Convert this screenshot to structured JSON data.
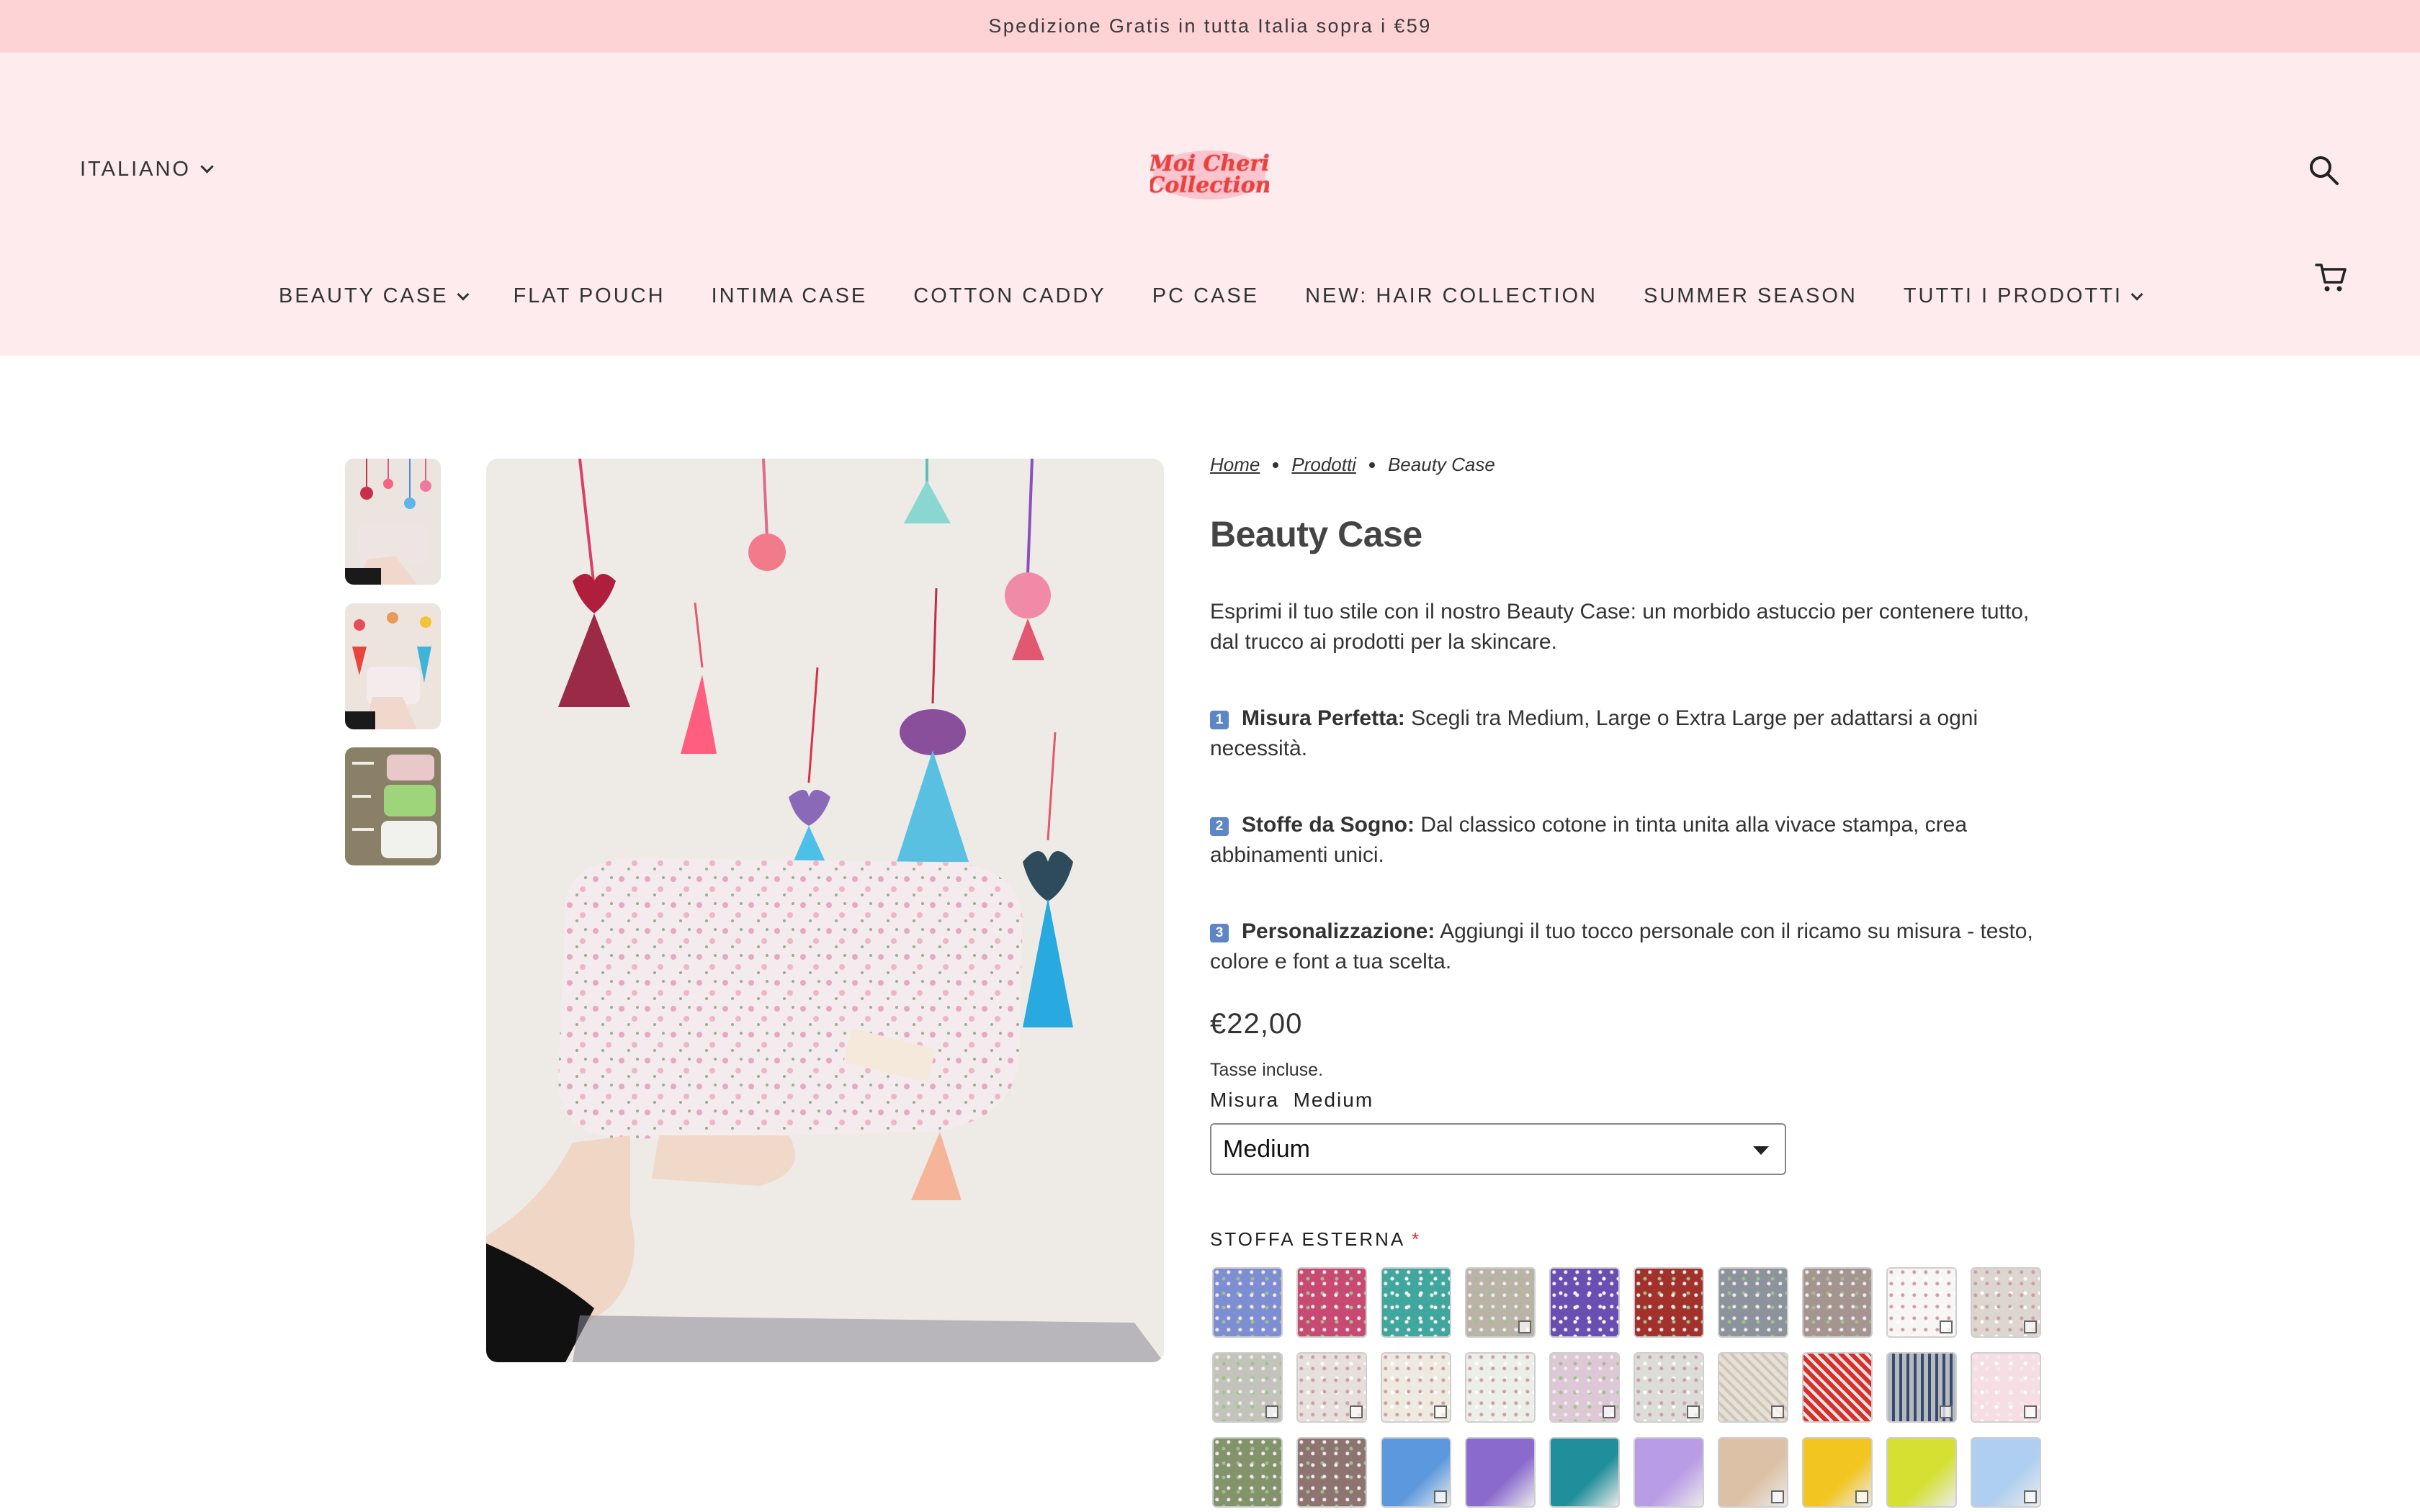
{
  "announcement": "Spedizione Gratis in tutta Italia sopra i €59",
  "header": {
    "language": "ITALIANO",
    "logo_text_line1": "Moi Cheri",
    "logo_text_line2": "Collection",
    "nav": [
      {
        "label": "BEAUTY CASE",
        "dropdown": true
      },
      {
        "label": "FLAT POUCH",
        "dropdown": false
      },
      {
        "label": "INTIMA CASE",
        "dropdown": false
      },
      {
        "label": "COTTON CADDY",
        "dropdown": false
      },
      {
        "label": "PC CASE",
        "dropdown": false
      },
      {
        "label": "NEW: HAIR COLLECTION",
        "dropdown": false
      },
      {
        "label": "SUMMER SEASON",
        "dropdown": false
      },
      {
        "label": "TUTTI I PRODOTTI",
        "dropdown": true
      }
    ]
  },
  "breadcrumb": {
    "home": "Home",
    "products": "Prodotti",
    "current": "Beauty Case"
  },
  "product": {
    "title": "Beauty Case",
    "description": "Esprimi il tuo stile con il nostro Beauty Case: un morbido astuccio per contenere tutto, dal trucco ai prodotti per la skincare.",
    "features": [
      {
        "num": "1",
        "title": "Misura Perfetta:",
        "text": " Scegli tra Medium, Large o Extra Large per adattarsi a ogni necessità."
      },
      {
        "num": "2",
        "title": "Stoffe da Sogno:",
        "text": " Dal classico cotone in tinta unita alla vivace stampa, crea abbinamenti unici."
      },
      {
        "num": "3",
        "title": "Personalizzazione:",
        "text": " Aggiungi il tuo tocco personale con il ricamo su misura - testo, colore e font a tua scelta."
      }
    ],
    "price": "€22,00",
    "tax_note": "Tasse incluse.",
    "size_label": "Misura",
    "size_value": "Medium",
    "size_selected": "Medium",
    "fabric_label": "STOFFA ESTERNA",
    "fabric_required": "*"
  },
  "colors": {
    "announce_bg": "#fdd3d6",
    "header_bg": "#fdebed",
    "logo_red": "#e8433a",
    "logo_pink": "#f7a5b5"
  },
  "swatches": [
    {
      "bg": "#7e8ed3",
      "pattern": "floral-blue",
      "zoom": false
    },
    {
      "bg": "#c84a72",
      "pattern": "floral-pink",
      "zoom": false
    },
    {
      "bg": "#3fa79e",
      "pattern": "paisley-teal",
      "zoom": false
    },
    {
      "bg": "#b9b3a8",
      "pattern": "floral-grey",
      "zoom": true
    },
    {
      "bg": "#6a4fb3",
      "pattern": "dots-purple",
      "zoom": false
    },
    {
      "bg": "#a3312b",
      "pattern": "floral-red",
      "zoom": false
    },
    {
      "bg": "#8c939c",
      "pattern": "floral-slate",
      "zoom": false
    },
    {
      "bg": "#a59590",
      "pattern": "floral-mauve",
      "zoom": false
    },
    {
      "bg": "#f8f6f4",
      "pattern": "sparse-white",
      "zoom": true
    },
    {
      "bg": "#ddd6ce",
      "pattern": "speckle-beige",
      "zoom": true
    },
    {
      "bg": "#c2c4bb",
      "pattern": "floral-sage",
      "zoom": true
    },
    {
      "bg": "#e6dfdc",
      "pattern": "bows-pink",
      "zoom": true
    },
    {
      "bg": "#eeeadf",
      "pattern": "bows-blue",
      "zoom": true
    },
    {
      "bg": "#eceee8",
      "pattern": "bows-sage",
      "zoom": false
    },
    {
      "bg": "#ddc8d6",
      "pattern": "floral-lilac",
      "zoom": true
    },
    {
      "bg": "#dcdcd8",
      "pattern": "bows-grey",
      "zoom": true
    },
    {
      "bg": "#e7e0d6",
      "pattern": "stripes-cream",
      "zoom": true
    },
    {
      "bg": "#d6302c",
      "pattern": "stripes-red",
      "zoom": false
    },
    {
      "bg": "#b3bac4",
      "pattern": "stripes-navy",
      "zoom": true
    },
    {
      "bg": "#f6dfe4",
      "pattern": "dots-pink",
      "zoom": true
    },
    {
      "bg": "#83936b",
      "pattern": "floral-olive",
      "zoom": false
    },
    {
      "bg": "#8e7470",
      "pattern": "floral-brown",
      "zoom": false
    },
    {
      "bg": "#5c98dd",
      "pattern": "solid-blue",
      "zoom": true
    },
    {
      "bg": "#8a6acc",
      "pattern": "solid-purple",
      "zoom": false
    },
    {
      "bg": "#208f9b",
      "pattern": "solid-teal",
      "zoom": false
    },
    {
      "bg": "#b99ce6",
      "pattern": "solid-lavender",
      "zoom": false
    },
    {
      "bg": "#dcc1a6",
      "pattern": "solid-tan",
      "zoom": true
    },
    {
      "bg": "#f2c521",
      "pattern": "solid-yellow",
      "zoom": true
    },
    {
      "bg": "#d5e033",
      "pattern": "solid-lime",
      "zoom": false
    },
    {
      "bg": "#aecff0",
      "pattern": "solid-lightblue",
      "zoom": true
    }
  ]
}
